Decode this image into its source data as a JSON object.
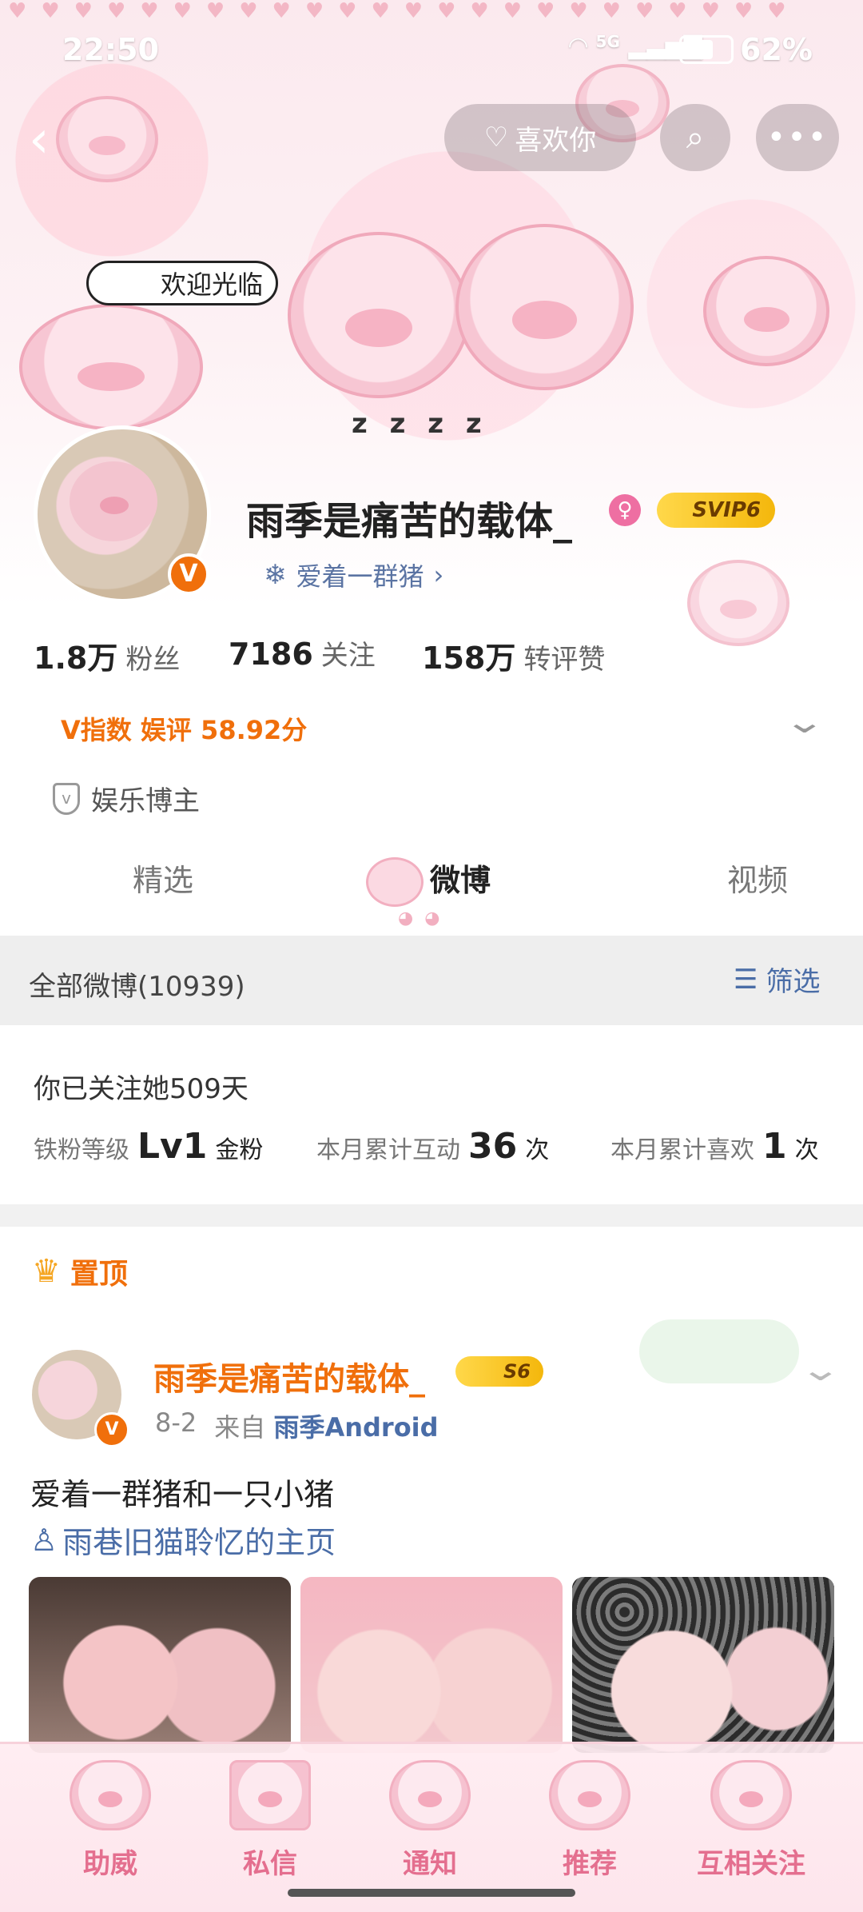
{
  "status_bar": {
    "time": "22:50",
    "network": "5G",
    "battery": "62%"
  },
  "top_nav": {
    "like_label": "喜欢你"
  },
  "sticker_text": "欢迎光临",
  "profile": {
    "name": "雨季是痛苦的载体_",
    "vip_badge": "SVIP6",
    "tag": "爱着一群猪",
    "stats": [
      {
        "value": "1.8万",
        "label": "粉丝"
      },
      {
        "value": "7186",
        "label": "关注"
      },
      {
        "value": "158万",
        "label": "转评赞"
      }
    ],
    "v_index": "V指数 娱评 58.92分",
    "role": "娱乐博主"
  },
  "tabs": {
    "featured": "精选",
    "weibo": "微博",
    "video": "视频"
  },
  "filter_bar": {
    "title": "全部微博(10939)",
    "filter_label": "筛选"
  },
  "fan_info": {
    "followed_days": "你已关注她509天",
    "level_label": "铁粉等级",
    "level_value": "Lv1",
    "level_tier": "金粉",
    "interact_label": "本月累计互动",
    "interact_value": "36",
    "interact_unit": "次",
    "like_label": "本月累计喜欢",
    "like_value": "1",
    "like_unit": "次"
  },
  "pinned": {
    "label": "置顶",
    "author": "雨季是痛苦的载体_",
    "author_badge": "S6",
    "date": "8-2",
    "from_label": "来自",
    "source": "雨季Android",
    "text": "爱着一群猪和一只小猪",
    "link_text": "雨巷旧猫聆忆的主页"
  },
  "bottom_bar": [
    {
      "label": "助威"
    },
    {
      "label": "私信"
    },
    {
      "label": "通知"
    },
    {
      "label": "推荐"
    },
    {
      "label": "互相关注"
    }
  ],
  "colors": {
    "accent_orange": "#f06f0b",
    "link_blue": "#4a6da7",
    "pink": "#e46f8f"
  }
}
